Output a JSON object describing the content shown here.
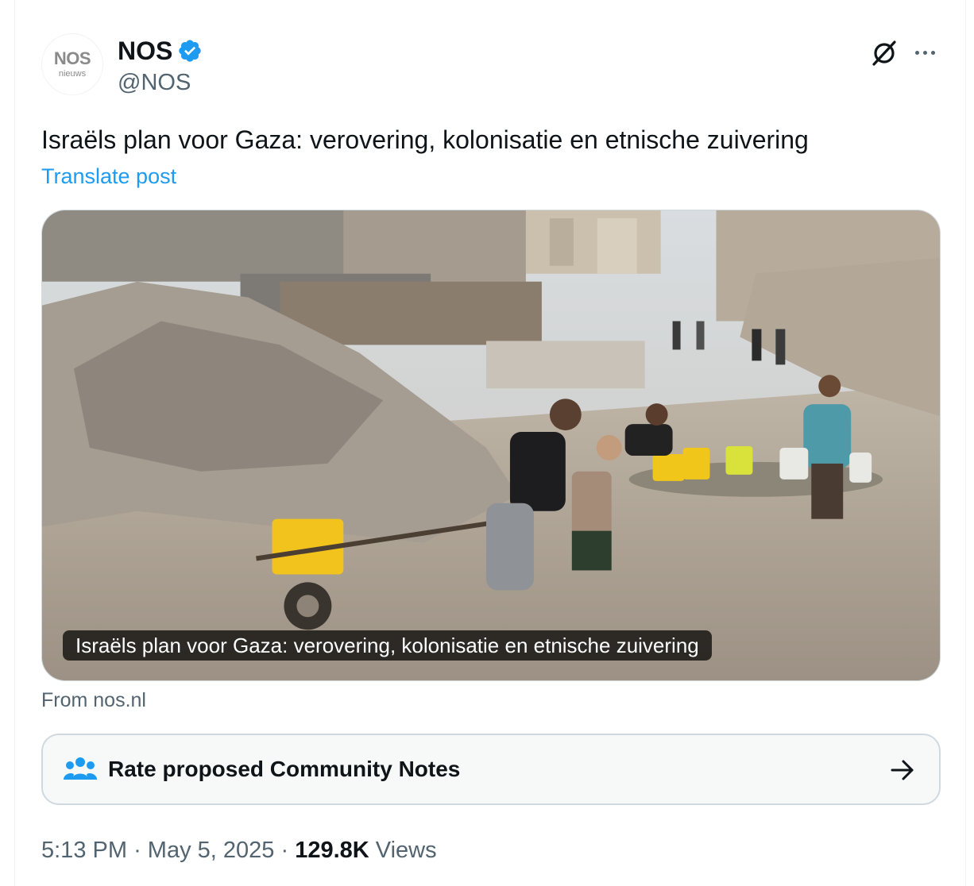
{
  "author": {
    "avatar_logo_top": "NOS",
    "avatar_logo_bottom": "nieuws",
    "display_name": "NOS",
    "handle": "@NOS",
    "verified_color": "#1d9bf0"
  },
  "header_icons": [
    "grok-icon",
    "more-icon"
  ],
  "post": {
    "text": "Israëls plan voor Gaza: verovering, kolonisatie en etnische zuivering",
    "translate_label": "Translate post"
  },
  "media": {
    "caption": "Israëls plan voor Gaza: verovering, kolonisatie en etnische zuivering",
    "source_label": "From nos.nl"
  },
  "community_notes": {
    "label": "Rate proposed Community Notes",
    "icon": "people-icon",
    "arrow_icon": "arrow-right-icon"
  },
  "meta": {
    "time": "5:13 PM",
    "separator": "·",
    "date": "May 5, 2025",
    "views_count": "129.8K",
    "views_label": "Views"
  },
  "colors": {
    "accent": "#1d9bf0",
    "text_primary": "#0f1419",
    "text_secondary": "#536471",
    "border": "#cfd9de"
  }
}
